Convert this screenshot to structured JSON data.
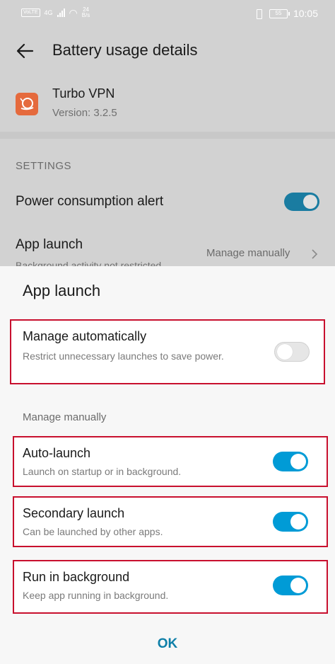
{
  "status_bar": {
    "carrier_chip": "VoLTE",
    "network": "4G",
    "speed_value": "24",
    "speed_unit": "B/s",
    "battery": "55",
    "time": "10:05"
  },
  "header": {
    "title": "Battery usage details"
  },
  "app": {
    "name": "Turbo VPN",
    "version": "Version: 3.2.5",
    "icon_color": "#e56a3d"
  },
  "settings": {
    "section_label": "SETTINGS",
    "power_alert": {
      "label": "Power consumption alert",
      "enabled": true
    },
    "app_launch": {
      "label": "App launch",
      "sub": "Background activity not restricted",
      "value": "Manage manually"
    }
  },
  "sheet": {
    "title": "App launch",
    "auto": {
      "title": "Manage automatically",
      "sub": "Restrict unnecessary launches to save power.",
      "enabled": false
    },
    "manual_label": "Manage manually",
    "options": [
      {
        "title": "Auto-launch",
        "sub": "Launch on startup or in background.",
        "enabled": true
      },
      {
        "title": "Secondary launch",
        "sub": "Can be launched by other apps.",
        "enabled": true
      },
      {
        "title": "Run in background",
        "sub": "Keep app running in background.",
        "enabled": true
      }
    ],
    "ok_label": "OK"
  },
  "colors": {
    "accent": "#009bd6",
    "highlight_border": "#c8102e",
    "ok_text": "#0e7fa8"
  }
}
